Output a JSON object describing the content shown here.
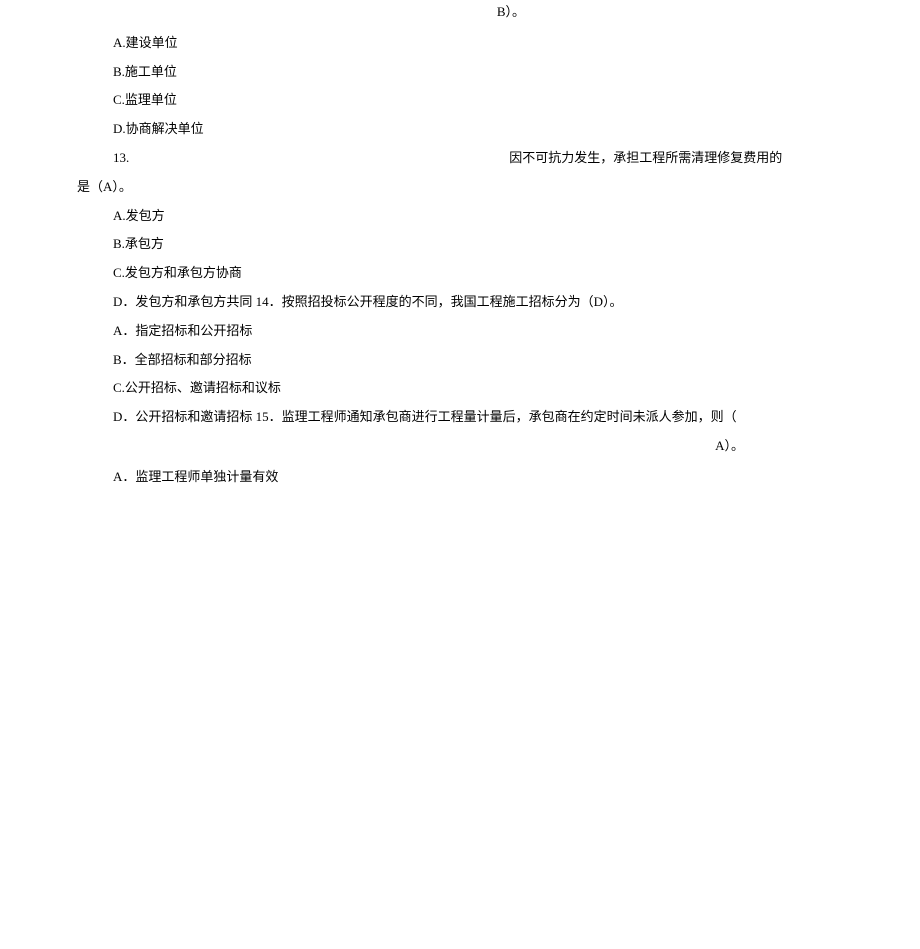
{
  "header_b": "B）。",
  "q12": {
    "optA": "A.建设单位",
    "optB": "B.施工单位",
    "optC": "C.监理单位",
    "optD": "D.协商解决单位"
  },
  "q13": {
    "num": "13.",
    "stem_right": "因不可抗力发生，承担工程所需清理修复费用的",
    "stem_cont": "是（A）。",
    "optA": "A.发包方",
    "optB": "B.承包方",
    "optC": "C.发包方和承包方协商",
    "optD_and_q14": "D．发包方和承包方共同 14．按照招投标公开程度的不同，我国工程施工招标分为（D）。"
  },
  "q14": {
    "optA": "A．指定招标和公开招标",
    "optB": "B．全部招标和部分招标",
    "optC": "C.公开招标、邀请招标和议标",
    "optD_and_q15": "D．公开招标和邀请招标 15．监理工程师通知承包商进行工程量计量后，承包商在约定时间未派人参加，则（",
    "q15_answer": "A）。"
  },
  "q15": {
    "optA": "A．监理工程师单独计量有效"
  }
}
